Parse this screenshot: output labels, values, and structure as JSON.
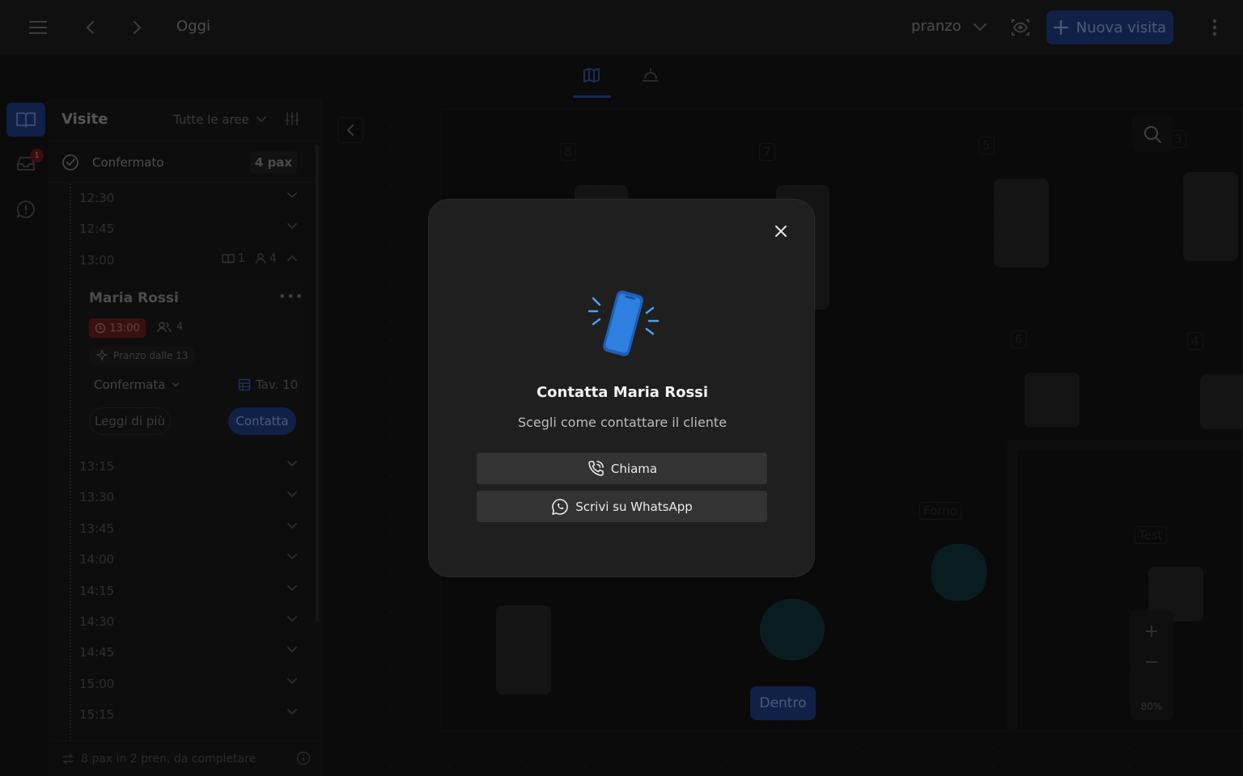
{
  "header": {
    "date_label": "Oggi",
    "shift_label": "pranzo",
    "new_visit_label": "Nuova visita"
  },
  "rail": {
    "inbox_badge": "1"
  },
  "panel": {
    "title": "Visite",
    "area_filter": "Tutte le aree",
    "status_label": "Confermato",
    "status_pax": "4 pax",
    "slots_top": [
      "12:30",
      "12:45"
    ],
    "slot_open": {
      "time": "13:00",
      "reservations": "1",
      "covers": "4"
    },
    "card": {
      "name": "Maria Rossi",
      "time": "13:00",
      "guests": "4",
      "offer": "Pranzo dalle 13",
      "status": "Confermata",
      "table": "Tav. 10",
      "read_more": "Leggi di più",
      "contact": "Contatta"
    },
    "slots_bottom": [
      "13:15",
      "13:30",
      "13:45",
      "14:00",
      "14:15",
      "14:30",
      "14:45",
      "15:00",
      "15:15"
    ],
    "footer_text": "8 pax in 2 pren. da completare"
  },
  "floor": {
    "table_numbers": [
      "8",
      "7",
      "5",
      "3",
      "6",
      "4"
    ],
    "area_labels": [
      "Forno",
      "Test"
    ],
    "zoom_level": "80%",
    "inside_button": "Dentro"
  },
  "modal": {
    "title": "Contatta Maria Rossi",
    "subtitle": "Scegli come contattare il cliente",
    "call_label": "Chiama",
    "whatsapp_label": "Scrivi su WhatsApp"
  },
  "colors": {
    "accent": "#1f3b80",
    "modal_bg": "#1f1f1f",
    "phone_blue": "#2f7fe0"
  }
}
